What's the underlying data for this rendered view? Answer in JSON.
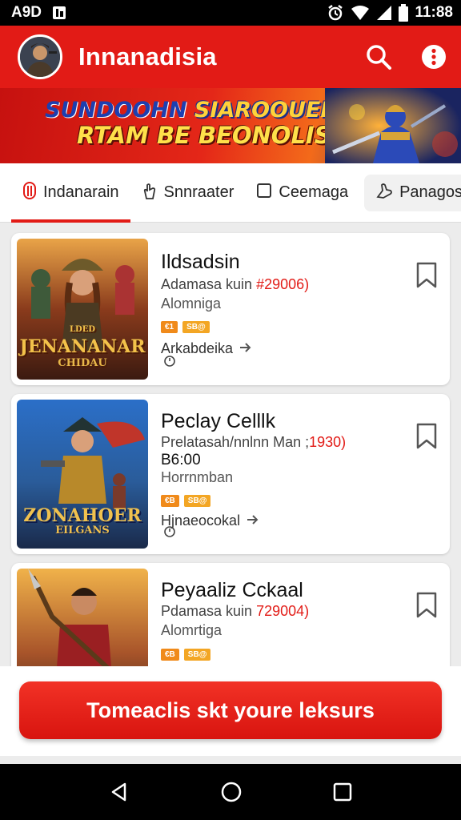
{
  "status_bar": {
    "left_text": "A9D",
    "time": "11:88"
  },
  "app_bar": {
    "title": "Innanadisia",
    "avatar_icon": "user-avatar",
    "search_icon": "search-icon",
    "more_icon": "more-vert-icon"
  },
  "banner": {
    "line1_part1": "SUNDOOHN",
    "line1_part2": "SIAROOUEH",
    "line2": "RTAM BE BEONOLIS"
  },
  "tabs": [
    {
      "label": "Indanarain",
      "icon": "pill-icon",
      "active": true
    },
    {
      "label": "Snnraater",
      "icon": "hand-icon",
      "active": false
    },
    {
      "label": "Ceemaga",
      "icon": "square-icon",
      "active": false
    },
    {
      "label": "Panagos·",
      "icon": "pointer-icon",
      "active": false
    }
  ],
  "cards": [
    {
      "title": "Ildsadsin",
      "subtitle": "Adamasa kuin",
      "price_tag": "#29006)",
      "line2": "Alomniga",
      "tags": [
        "€1",
        "SB@"
      ],
      "author": "Arkabdeika",
      "thumb_title": "JENANANAR",
      "thumb_sub": "CHIDAU",
      "thumb_top": "LDED"
    },
    {
      "title": "Peclay Celllk",
      "subtitle": "Prelatasah/nnlnn Man ;",
      "price_tag": "1930)",
      "price": "B6:00",
      "line2": "Horrnmban",
      "tags": [
        "€B",
        "SB@"
      ],
      "author": "Hjnaeocokal",
      "thumb_title": "ZONAHOER",
      "thumb_sub": "EILGANS"
    },
    {
      "title": "Peyaaliz Cckaal",
      "subtitle": "Pdamasa kuin",
      "price_tag": "729004)",
      "line2": "Alomrtiga",
      "tags": [
        "€B",
        "SB@"
      ]
    }
  ],
  "cta": {
    "label": "Tomeaclis skt youre leksurs"
  },
  "colors": {
    "primary": "#e21b16",
    "banner_yellow": "#ffd23a",
    "banner_blue": "#1d3fb0"
  }
}
